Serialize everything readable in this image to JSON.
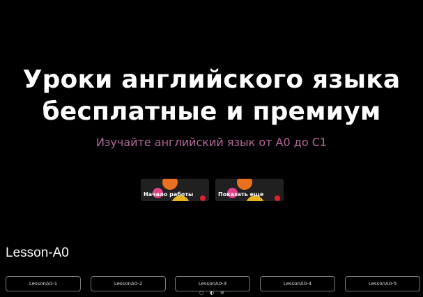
{
  "hero": {
    "title_line1": "Уроки английского языка",
    "title_line2": "бесплатные и премиум",
    "subtitle": "Изучайте английский язык от А0 до С1",
    "subtitle_color": "#b56a9c"
  },
  "cta": {
    "start_label": "Начало работы",
    "more_label": "Показать еще"
  },
  "section": {
    "title": "Lesson-A0"
  },
  "lessons": [
    {
      "label": "LessonA0-1"
    },
    {
      "label": "LessonA0-2"
    },
    {
      "label": "LessonA0-3"
    },
    {
      "label": "LessonA0-4"
    },
    {
      "label": "LessonA0-5"
    }
  ],
  "toolbar": {
    "icons": [
      "comment-icon",
      "theme-toggle-icon",
      "menu-icon"
    ],
    "glyphs": [
      "○",
      "◐",
      "≡"
    ]
  },
  "colors": {
    "background": "#000000",
    "dot_orange": "#e8701e",
    "dot_pink": "#e0408a",
    "dot_yellow": "#e8b420",
    "dot_red": "#e02030"
  }
}
